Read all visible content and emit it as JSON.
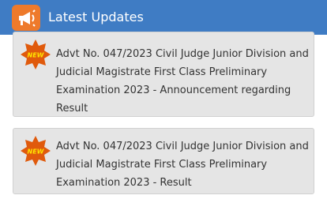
{
  "header": {
    "title": "Latest Updates",
    "icon": "megaphone-icon",
    "background": "#3f7cc4",
    "icon_background": "#ee7a2b"
  },
  "updates": [
    {
      "badge": "NEW",
      "text": "Advt No. 047/2023 Civil Judge Junior Division and Judicial Magistrate First Class Preliminary Examination 2023 - Announcement regarding Result"
    },
    {
      "badge": "NEW",
      "text": "Advt No. 047/2023 Civil Judge Junior Division and Judicial Magistrate First Class Preliminary Examination 2023 - Result"
    }
  ],
  "colors": {
    "card_background": "#e5e5e5",
    "badge": "#e05a0c",
    "text": "#333333"
  }
}
